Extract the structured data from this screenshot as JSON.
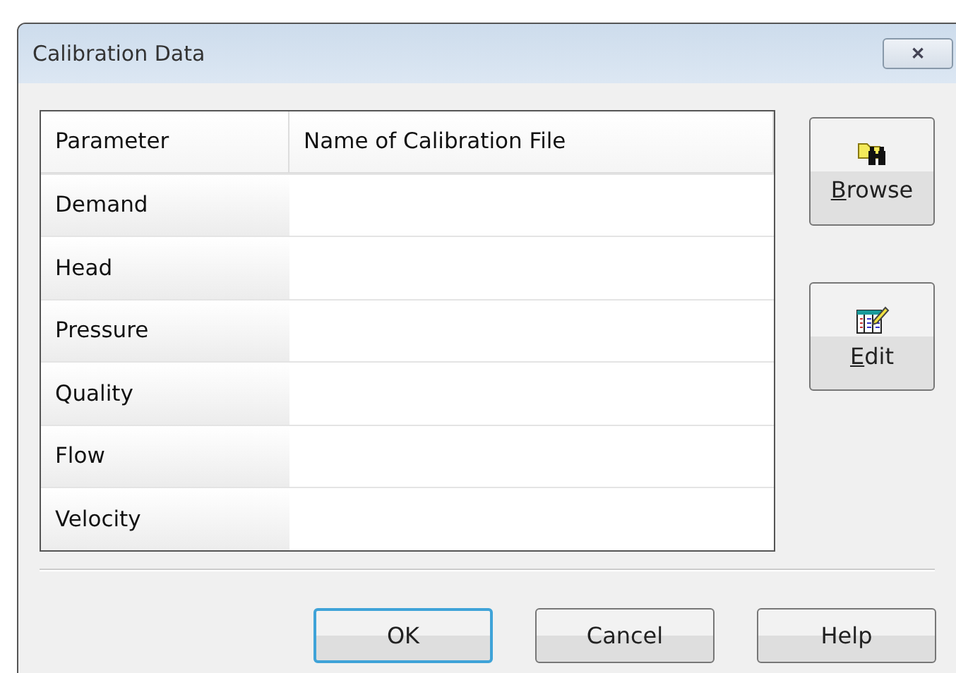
{
  "window": {
    "title": "Calibration Data",
    "close": "✕"
  },
  "table": {
    "columns": [
      "Parameter",
      "Name of Calibration File"
    ],
    "rows": [
      {
        "parameter": "Demand"
      },
      {
        "parameter": "Head"
      },
      {
        "parameter": "Pressure"
      },
      {
        "parameter": "Quality"
      },
      {
        "parameter": "Flow"
      },
      {
        "parameter": "Velocity"
      }
    ]
  },
  "side_buttons": [
    {
      "label": "Browse",
      "kind": "browse",
      "underline_first": true
    },
    {
      "label": "Edit",
      "kind": "edit",
      "underline_first": true
    }
  ],
  "buttons": [
    {
      "label": "OK",
      "default": true
    },
    {
      "label": "Cancel",
      "default": false
    },
    {
      "label": "Help",
      "default": false
    }
  ]
}
